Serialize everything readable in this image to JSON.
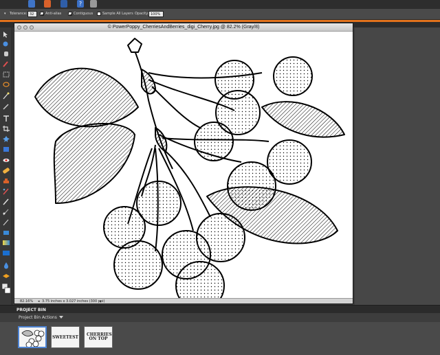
{
  "options_bar": {
    "tolerance_label": "Tolerance:",
    "tolerance_value": "32",
    "anti_alias_label": "Anti-alias",
    "anti_alias_checked": true,
    "contiguous_label": "Contiguous",
    "contiguous_checked": true,
    "sample_all_layers_label": "Sample All Layers",
    "sample_all_layers_checked": false,
    "opacity_label": "Opacity:",
    "opacity_value": "100%"
  },
  "document": {
    "title": "© PowerPoppy_CherriesAndBerries_digi_Cherry.jpg @ 82.2% (Gray/8)",
    "zoom": "82.16%",
    "size_info": "3.75 inches x 3.027 inches (300 ppi)"
  },
  "project_bin": {
    "tab_label": "PROJECT BIN",
    "actions_label": "Project Bin Actions",
    "thumbnails": [
      {
        "name": "cherry",
        "selected": true,
        "text": ""
      },
      {
        "name": "sweetest",
        "selected": false,
        "text": "SWEETEST"
      },
      {
        "name": "cherries-on-top",
        "selected": false,
        "text": "CHERRIES ON TOP"
      }
    ]
  },
  "colors": {
    "accent": "#e2721c",
    "selection": "#4e84d4",
    "panel": "#3b3b3b"
  }
}
